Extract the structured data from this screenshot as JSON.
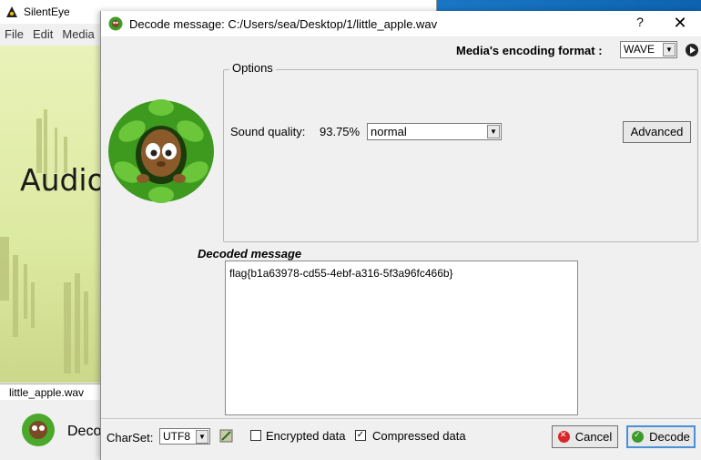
{
  "main_window": {
    "title": "SilentEye",
    "menu": [
      "File",
      "Edit",
      "Media"
    ],
    "canvas_text": "Audio",
    "file_name": "little_apple.wav",
    "bottom_text": "Deco"
  },
  "dialog": {
    "title": "Decode message: C:/Users/sea/Desktop/1/little_apple.wav",
    "help_label": "?",
    "close_label": "✕",
    "format_label": "Media's encoding format :",
    "format_value": "WAVE",
    "options_legend": "Options",
    "sound_quality_label": "Sound quality:",
    "sound_quality_value": "93.75%",
    "quality_select_value": "normal",
    "advanced_label": "Advanced",
    "decoded_label": "Decoded message",
    "decoded_text": "flag{b1a63978-cd55-4ebf-a316-5f3a96fc466b}",
    "charset_label": "CharSet:",
    "charset_value": "UTF8",
    "encrypted_label": "Encrypted data",
    "encrypted_checked": false,
    "compressed_label": "Compressed data",
    "compressed_checked": true,
    "cancel_label": "Cancel",
    "decode_label": "Decode"
  },
  "colors": {
    "accent": "#4a90d9",
    "cancel": "#d8262a",
    "decode": "#3a9a2a",
    "canvas": "#e9f2b9"
  }
}
